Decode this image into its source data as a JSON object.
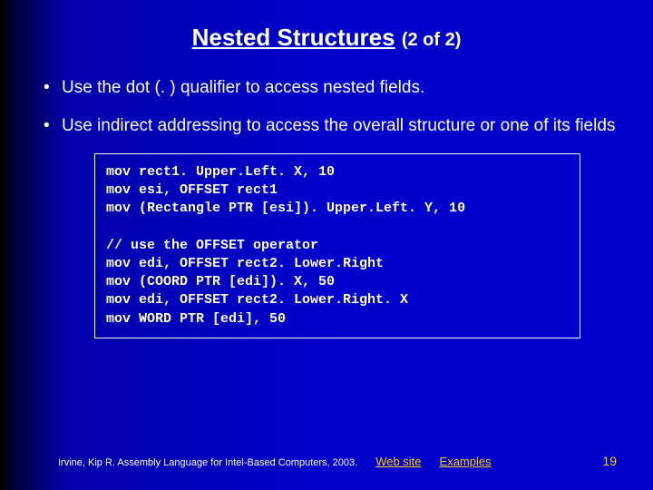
{
  "title": {
    "main": "Nested Structures",
    "sub": "(2 of 2)"
  },
  "bullets": [
    "Use the dot (. ) qualifier to access nested fields.",
    "Use indirect addressing to access the overall structure or one of its fields"
  ],
  "code": "mov rect1. Upper.Left. X, 10\nmov esi, OFFSET rect1\nmov (Rectangle PTR [esi]). Upper.Left. Y, 10\n\n// use the OFFSET operator\nmov edi, OFFSET rect2. Lower.Right\nmov (COORD PTR [edi]). X, 50\nmov edi, OFFSET rect2. Lower.Right. X\nmov WORD PTR [edi], 50",
  "footer": {
    "citation": "Irvine, Kip R. Assembly Language for Intel-Based Computers, 2003.",
    "link1": "Web site",
    "link2": "Examples",
    "page": "19"
  }
}
